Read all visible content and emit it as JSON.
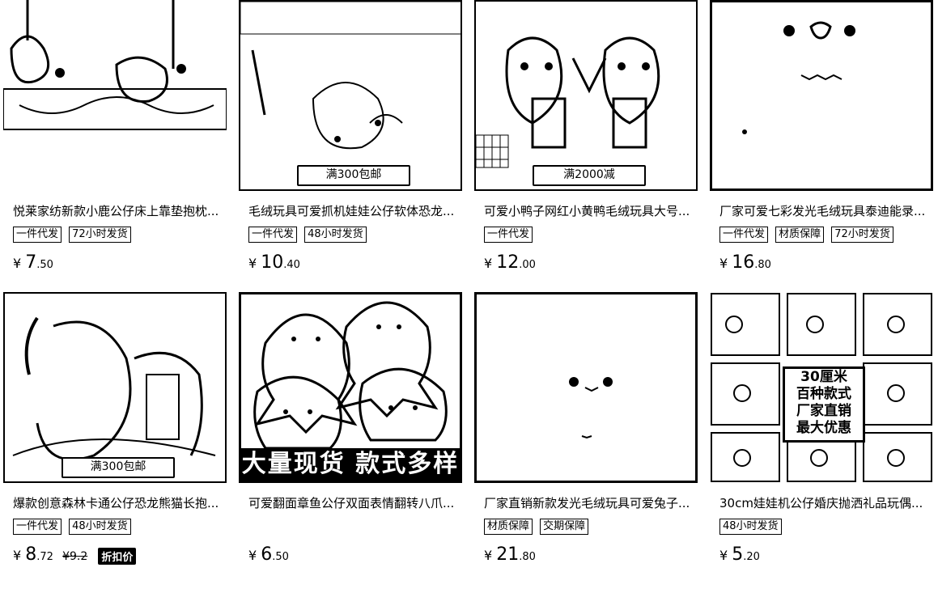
{
  "products": [
    {
      "title": "悦莱家纺新款小鹿公仔床上靠垫抱枕...",
      "tags": [
        "一件代发",
        "72小时发货"
      ],
      "currency": "¥",
      "price_int": "7",
      "price_dec": ".50",
      "banner": ""
    },
    {
      "title": "毛绒玩具可爱抓机娃娃公仔软体恐龙...",
      "tags": [
        "一件代发",
        "48小时发货"
      ],
      "currency": "¥",
      "price_int": "10",
      "price_dec": ".40",
      "banner": "满300包邮"
    },
    {
      "title": "可爱小鸭子网红小黄鸭毛绒玩具大号...",
      "tags": [
        "一件代发"
      ],
      "currency": "¥",
      "price_int": "12",
      "price_dec": ".00",
      "banner": "满2000减"
    },
    {
      "title": "厂家可爱七彩发光毛绒玩具泰迪能录...",
      "tags": [
        "一件代发",
        "材质保障",
        "72小时发货"
      ],
      "currency": "¥",
      "price_int": "16",
      "price_dec": ".80",
      "banner": ""
    },
    {
      "title": "爆款创意森林卡通公仔恐龙熊猫长抱...",
      "tags": [
        "一件代发",
        "48小时发货"
      ],
      "currency": "¥",
      "price_int": "8",
      "price_dec": ".72",
      "orig_price": "¥9.2",
      "discount": "折扣价",
      "banner": "满300包邮"
    },
    {
      "title": "可爱翻面章鱼公仔双面表情翻转八爪...",
      "tags": [],
      "currency": "¥",
      "price_int": "6",
      "price_dec": ".50",
      "big_banner": "大量现货 款式多样"
    },
    {
      "title": "厂家直销新款发光毛绒玩具可爱兔子...",
      "tags": [
        "材质保障",
        "交期保障"
      ],
      "currency": "¥",
      "price_int": "21",
      "price_dec": ".80"
    },
    {
      "title": "30cm娃娃机公仔婚庆抛洒礼品玩偶...",
      "tags": [
        "48小时发货"
      ],
      "currency": "¥",
      "price_int": "5",
      "price_dec": ".20",
      "stamp": [
        "30厘米",
        "百种款式",
        "厂家直销",
        "最大优惠"
      ]
    }
  ]
}
